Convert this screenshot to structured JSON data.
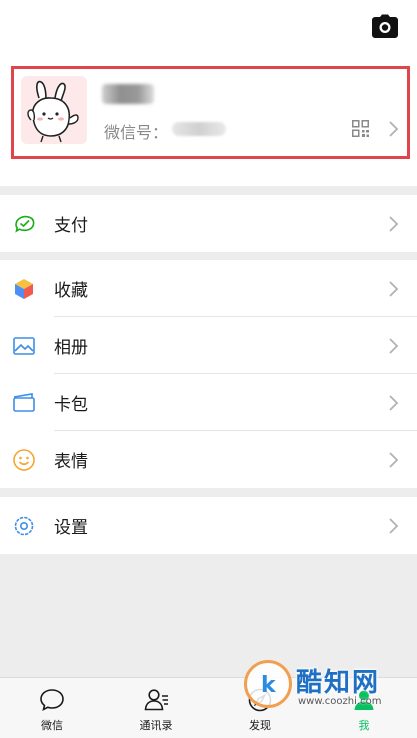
{
  "profile": {
    "wechat_id_label": "微信号："
  },
  "menu": {
    "pay": {
      "label": "支付",
      "icon": "wechat-pay-icon"
    },
    "favorites": {
      "label": "收藏",
      "icon": "favorites-cube-icon"
    },
    "album": {
      "label": "相册",
      "icon": "album-picture-icon"
    },
    "cards": {
      "label": "卡包",
      "icon": "card-wallet-icon"
    },
    "stickers": {
      "label": "表情",
      "icon": "smiley-icon"
    },
    "settings": {
      "label": "设置",
      "icon": "gear-icon"
    }
  },
  "tabbar": {
    "tabs": [
      {
        "label": "微信",
        "icon": "chat-bubble-icon"
      },
      {
        "label": "通讯录",
        "icon": "contacts-icon"
      },
      {
        "label": "发现",
        "icon": "compass-icon"
      },
      {
        "label": "我",
        "icon": "person-icon",
        "active": true
      }
    ]
  },
  "watermark": {
    "title": "酷知网",
    "url": "www.coozhi.com"
  },
  "colors": {
    "accent_green": "#07c160",
    "highlight_red": "#e0454b",
    "background": "#ededed"
  }
}
